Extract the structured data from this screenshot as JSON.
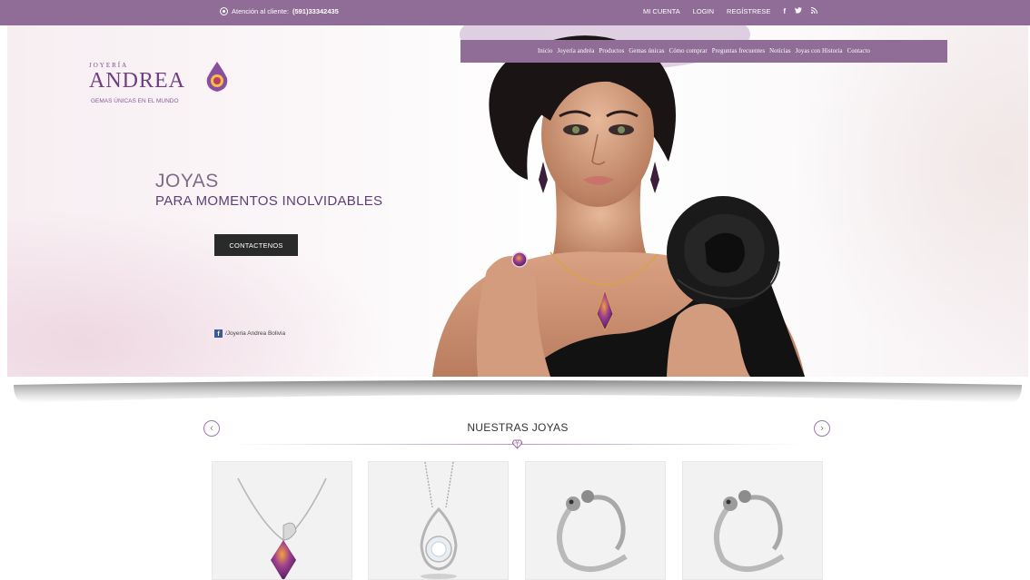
{
  "topbar": {
    "support_label": "Atención al cliente:",
    "support_phone": "(591)33342435",
    "links": [
      "MI CUENTA",
      "LOGIN",
      "REGÍSTRESE"
    ],
    "social_icons": [
      "facebook-icon",
      "twitter-icon",
      "rss-icon"
    ]
  },
  "logo": {
    "top": "JOYERÍA",
    "name": "ANDREA",
    "tagline": "GEMAS ÚNICAS EN EL MUNDO"
  },
  "nav": {
    "items": [
      "Inicio",
      "Joyería andréa",
      "Productos",
      "Gemas únicas",
      "Cómo comprar",
      "Preguntas frecuentes",
      "Noticias",
      "Joyas con Historia",
      "Contacto"
    ]
  },
  "hero": {
    "title": "JOYAS",
    "subtitle": "PARA MOMENTOS INOLVIDABLES",
    "cta": "CONTACTENOS",
    "facebook": "/Joyeria Andrea Bolivia"
  },
  "section": {
    "title": "NUESTRAS JOYAS",
    "prev_icon": "chevron-left-icon",
    "next_icon": "chevron-right-icon"
  },
  "products": [
    {
      "kind": "amethyst-pendant-necklace"
    },
    {
      "kind": "diamond-pendant-necklace"
    },
    {
      "kind": "silver-bangle-bracelet"
    },
    {
      "kind": "silver-bangle-bracelet"
    }
  ],
  "colors": {
    "accent": "#8f6d97",
    "brand": "#6f3d82",
    "button": "#2a2a2a"
  }
}
